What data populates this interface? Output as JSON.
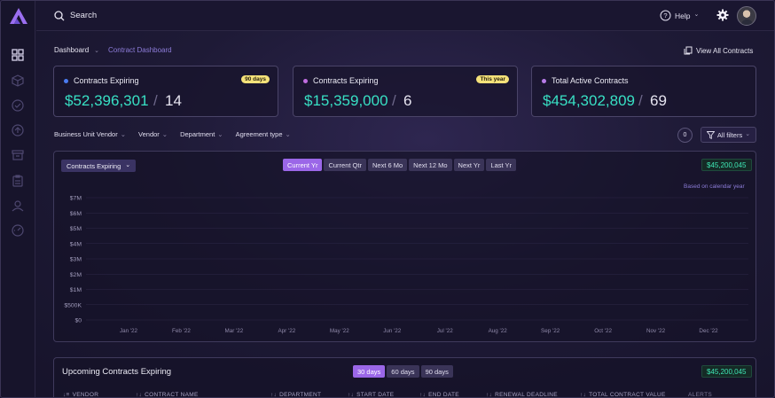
{
  "topbar": {
    "search_label": "Search",
    "help_label": "Help",
    "help_chevron": "⌄"
  },
  "breadcrumb": {
    "home": "Dashboard",
    "chevron": "⌄",
    "current": "Contract Dashboard"
  },
  "header_actions": {
    "view_all": "View All Contracts"
  },
  "cards": [
    {
      "title": "Contracts Expiring",
      "badge": "90 days",
      "dot_color": "#4a7cf0",
      "value": "$52,396,301",
      "sep": "/",
      "count": "14"
    },
    {
      "title": "Contracts Expiring",
      "badge": "This year",
      "dot_color": "#c06de0",
      "value": "$15,359,000",
      "sep": "/",
      "count": "6"
    },
    {
      "title": "Total Active Contracts",
      "badge": "",
      "dot_color": "#b77be8",
      "value": "$454,302,809",
      "sep": "/",
      "count": "69"
    }
  ],
  "filters": {
    "items": [
      "Business Unit Vendor",
      "Vendor",
      "Department",
      "Agreement type"
    ],
    "chevron": "⌄",
    "count": "0",
    "all_filters": "All filters"
  },
  "chart_panel": {
    "dropdown_label": "Contracts Expiring",
    "dropdown_chevron": "⌄",
    "ranges": [
      "Current Yr",
      "Current Qtr",
      "Next 6 Mo",
      "Next 12 Mo",
      "Next Yr",
      "Last Yr"
    ],
    "active_range": "Current Yr",
    "total": "$45,200,045",
    "note": "Based on calendar year"
  },
  "chart_data": {
    "type": "line",
    "title": "",
    "xlabel": "",
    "ylabel": "",
    "y_ticks": [
      "$7M",
      "$6M",
      "$5M",
      "$4M",
      "$3M",
      "$2M",
      "$1M",
      "$500K",
      "$0"
    ],
    "categories": [
      "Jan '22",
      "Feb '22",
      "Mar '22",
      "Apr '22",
      "May '22",
      "Jun '22",
      "Jul '22",
      "Aug '22",
      "Sep '22",
      "Oct '22",
      "Nov '22",
      "Dec '22"
    ],
    "series": [],
    "grid": true,
    "legend": "none"
  },
  "upcoming": {
    "title": "Upcoming Contracts Expiring",
    "ranges": [
      "30 days",
      "60 days",
      "90 days"
    ],
    "active_range": "30 days",
    "total": "$45,200,045",
    "columns": [
      "VENDOR",
      "CONTRACT NAME",
      "DEPARTMENT",
      "START DATE",
      "END DATE",
      "RENEWAL DEADLINE",
      "TOTAL CONTRACT VALUE",
      "ALERTS"
    ]
  },
  "colors": {
    "accent": "#9b67e8",
    "money": "#38e0c4",
    "total_green": "#3ee6b4",
    "badge_yellow": "#f5e27a"
  },
  "icons": {
    "sidebar": [
      "dashboard-icon",
      "cube-icon",
      "check-circle-icon",
      "upload-icon",
      "archive-icon",
      "clipboard-icon",
      "user-icon",
      "speedometer-icon"
    ]
  }
}
